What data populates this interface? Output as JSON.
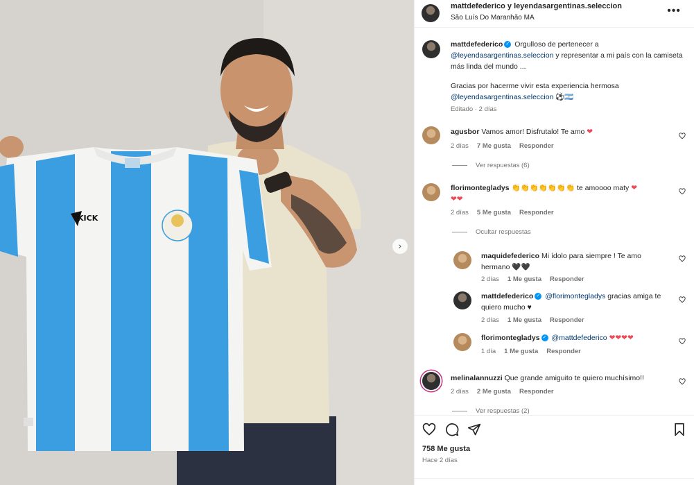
{
  "post": {
    "header_title": "mattdefederico y leyendasargentinas.seleccion",
    "location": "São Luís Do Maranhão MA",
    "caption_user": "mattdefederico",
    "caption_line1": "Orgulloso de pertenecer a",
    "caption_mention1": "@leyendasargentinas.seleccion",
    "caption_line2": "y representar a mi país con la camiseta más linda del mundo ...",
    "caption_line3": "Gracias por hacerme vivir esta experiencia hermosa",
    "caption_mention2": "@leyendasargentinas.seleccion",
    "caption_flag": "⚽🇦🇷",
    "caption_meta": "Editado · 2 días"
  },
  "comments": [
    {
      "user": "agusbor",
      "text": "Vamos amor! Disfrutalo! Te amo",
      "emoji": "❤",
      "time": "2 días",
      "likes": "7 Me gusta",
      "reply": "Responder",
      "replies_link": "Ver respuestas (6)"
    },
    {
      "user": "florimontegladys",
      "text": "👏👏👏👏👏👏👏 te amoooo maty",
      "emoji": "❤",
      "emoji2": "❤❤",
      "time": "2 días",
      "likes": "5 Me gusta",
      "reply": "Responder",
      "replies_link": "Ocultar respuestas"
    },
    {
      "user": "melinalannuzzi",
      "text": "Que grande amiguito te quiero muchísimo!!",
      "time": "2 días",
      "likes": "2 Me gusta",
      "reply": "Responder",
      "replies_link": "Ver respuestas (2)"
    }
  ],
  "replies": [
    {
      "user": "maquidefederico",
      "text": "Mi ídolo para siempre ! Te amo hermano",
      "emoji": "🖤🖤",
      "time": "2 días",
      "likes": "1 Me gusta",
      "reply": "Responder"
    },
    {
      "user": "mattdefederico",
      "mention": "@florimontegladys",
      "text": "gracias amiga te quiero mucho",
      "emoji": "♥",
      "time": "2 días",
      "likes": "1 Me gusta",
      "reply": "Responder"
    },
    {
      "user": "florimontegladys",
      "mention": "@mattdefederico",
      "emoji": "❤❤❤❤",
      "time": "1 día",
      "likes": "1 Me gusta",
      "reply": "Responder"
    }
  ],
  "footer": {
    "likes": "758 Me gusta",
    "ago": "Hace 2 días"
  },
  "icons": {
    "more": "more-horizontal-icon",
    "like": "heart-icon",
    "comment": "comment-icon",
    "share": "share-icon",
    "save": "bookmark-icon",
    "next": "chevron-right-icon"
  },
  "colors": {
    "mention": "#00376b",
    "heart": "#ed4956",
    "verified": "#0095f6",
    "shirt_blue": "#3b9ee0"
  },
  "photo": {
    "shirt_brand": "KICK"
  }
}
